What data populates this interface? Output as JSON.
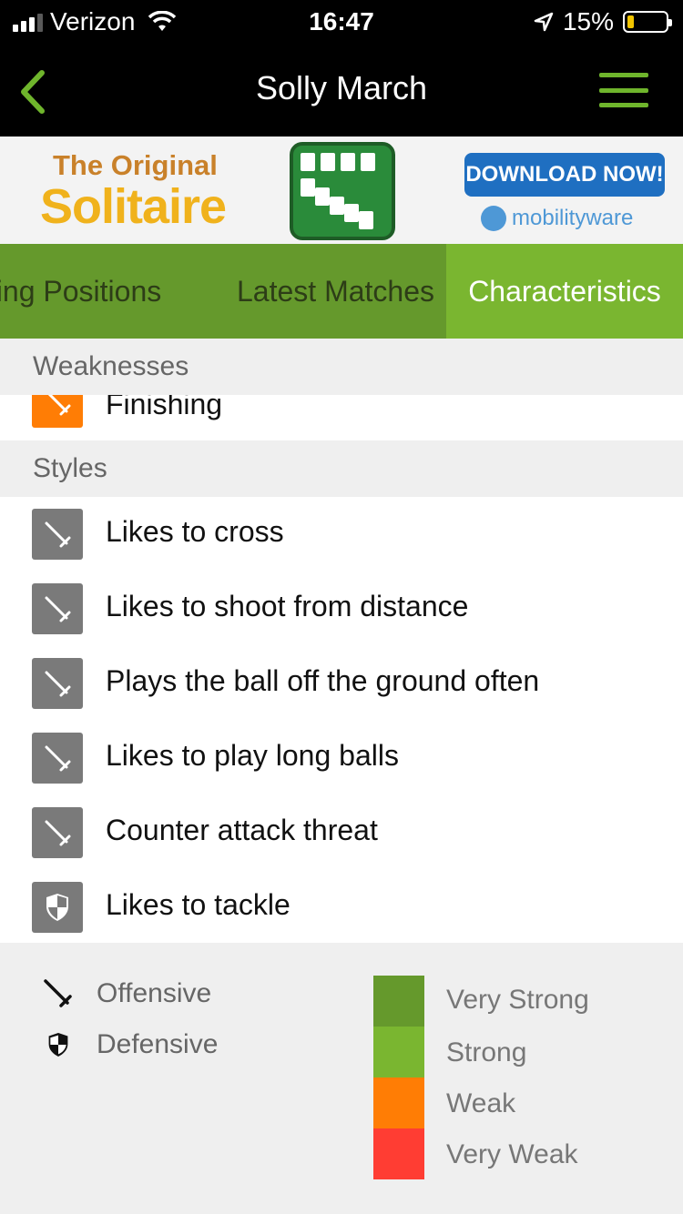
{
  "status_bar": {
    "carrier": "Verizon",
    "time": "16:47",
    "battery_percent": "15%"
  },
  "nav": {
    "title": "Solly March"
  },
  "ad": {
    "line1": "The Original",
    "line2": "Solitaire",
    "button": "DOWNLOAD NOW!",
    "brand": "mobilityware"
  },
  "tabs": [
    {
      "label": "Playing Positions",
      "visible_text": "aying Positions",
      "active": false
    },
    {
      "label": "Latest Matches",
      "active": false
    },
    {
      "label": "Characteristics",
      "active": true
    }
  ],
  "weaknesses": {
    "header": "Weaknesses",
    "items": [
      {
        "label": "Finishing",
        "type": "offensive",
        "level": "weak"
      }
    ]
  },
  "styles": {
    "header": "Styles",
    "items": [
      {
        "label": "Likes to cross",
        "type": "offensive"
      },
      {
        "label": "Likes to shoot from distance",
        "type": "offensive"
      },
      {
        "label": "Plays the ball off the ground often",
        "type": "offensive"
      },
      {
        "label": "Likes to play long balls",
        "type": "offensive"
      },
      {
        "label": "Counter attack threat",
        "type": "offensive"
      },
      {
        "label": "Likes to tackle",
        "type": "defensive"
      }
    ]
  },
  "legend": {
    "types": [
      {
        "label": "Offensive",
        "icon": "sword-icon"
      },
      {
        "label": "Defensive",
        "icon": "shield-icon"
      }
    ],
    "levels": [
      {
        "label": "Very Strong",
        "color": "#65992c"
      },
      {
        "label": "Strong",
        "color": "#7ab630"
      },
      {
        "label": "Weak",
        "color": "#ff7d05"
      },
      {
        "label": "Very Weak",
        "color": "#ff3d33"
      }
    ]
  },
  "colors": {
    "accent_green": "#6fb52c",
    "tab_bar": "#65992c",
    "active_tab": "#7ab630",
    "weak_orange": "#ff7d05",
    "style_gray": "#7a7a7a"
  }
}
